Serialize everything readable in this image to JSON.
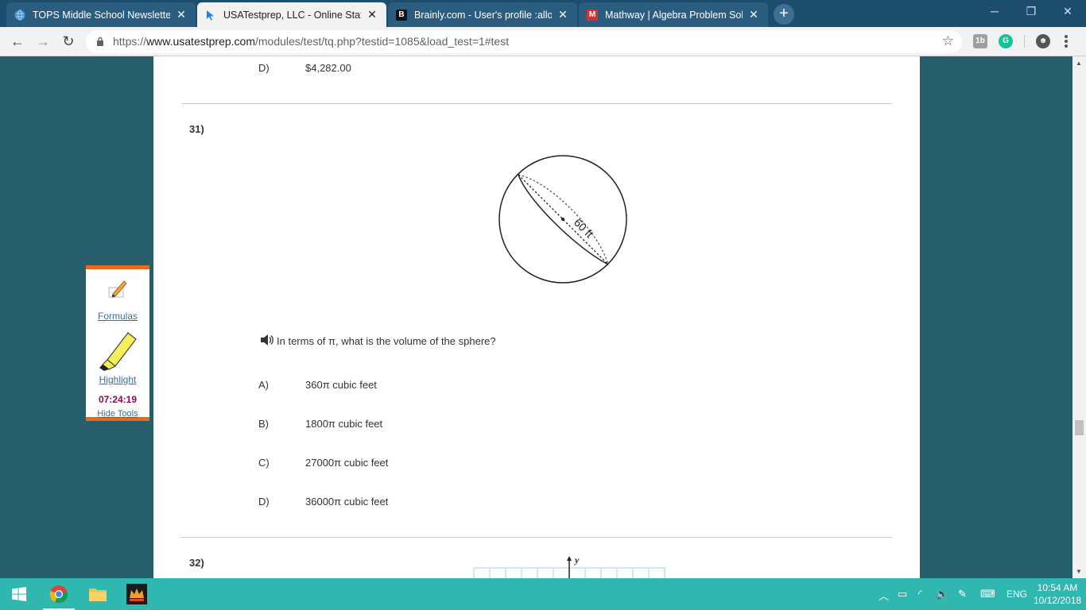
{
  "browser": {
    "tabs": [
      {
        "title": "TOPS Middle School Newsletter",
        "active": false
      },
      {
        "title": "USATestprep, LLC - Online State-Specific",
        "active": true
      },
      {
        "title": "Brainly.com - User's profile :allonsoc",
        "active": false
      },
      {
        "title": "Mathway | Algebra Problem Solver",
        "active": false
      }
    ],
    "url_scheme": "https://",
    "url_host": "www.usatestprep.com",
    "url_path": "/modules/test/tq.php?testid=1085&load_test=1#test",
    "ext_label": "1b"
  },
  "prev_question": {
    "option_letter": "D)",
    "option_text": "$4,282.00"
  },
  "question": {
    "number": "31)",
    "diagram_label": "60 ft",
    "text": "In terms of π, what is the volume of the sphere?",
    "options": [
      {
        "letter": "A)",
        "text": "360π cubic feet"
      },
      {
        "letter": "B)",
        "text": "1800π cubic feet"
      },
      {
        "letter": "C)",
        "text": "27000π cubic feet"
      },
      {
        "letter": "D)",
        "text": "36000π cubic feet"
      }
    ]
  },
  "next_question": {
    "number": "32)",
    "axis_label": "y"
  },
  "tools": {
    "formulas_label": "Formulas",
    "highlight_label": "Highlight",
    "timer": "07:24:19",
    "hide_label": "Hide Tools"
  },
  "taskbar": {
    "language": "ENG",
    "time": "10:54 AM",
    "date": "10/12/2018"
  }
}
